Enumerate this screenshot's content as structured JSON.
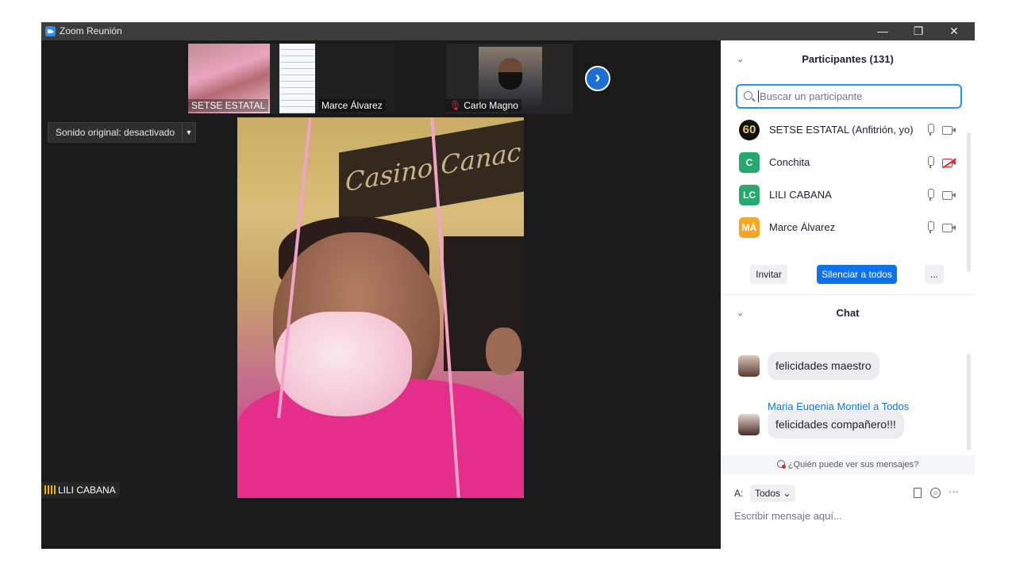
{
  "window": {
    "title": "Zoom Reunión",
    "controls": {
      "minimize": "—",
      "restore": "❐",
      "close": "✕"
    }
  },
  "gallery": {
    "thumbnails": [
      {
        "name": "SETSE ESTATAL",
        "muted": false
      },
      {
        "name": "Marce Álvarez",
        "muted": false
      },
      {
        "name": "Carlo Magno",
        "muted": true
      }
    ],
    "next_icon": "chevron-right-icon"
  },
  "sound_dropdown": {
    "label": "Sonido original: desactivado"
  },
  "main_video": {
    "speaker_name": "LILI CABANA",
    "sign_text": "Casino Canac"
  },
  "participants": {
    "title": "Participantes (131)",
    "search_placeholder": "Buscar un participante",
    "list": [
      {
        "initials": "60",
        "name": "SETSE ESTATAL (Anfitrión, yo)",
        "color": "#111111",
        "video_off": false
      },
      {
        "initials": "C",
        "name": "Conchita",
        "color": "#26a96c",
        "video_off": true
      },
      {
        "initials": "LC",
        "name": "LILI CABANA",
        "color": "#26a96c",
        "video_off": false
      },
      {
        "initials": "MÁ",
        "name": "Marce Álvarez",
        "color": "#f5a623",
        "video_off": false
      },
      {
        "initials": "",
        "name": "",
        "color": "#8e44ad",
        "video_off": false
      }
    ],
    "buttons": {
      "invite": "Invitar",
      "mute_all": "Silenciar a todos",
      "more": "..."
    }
  },
  "chat": {
    "title": "Chat",
    "messages": [
      {
        "sender": "",
        "text": "felicidades maestro"
      },
      {
        "sender": "Maria Eugenia Montiel a Todos",
        "text": "felicidades compañero!!!"
      }
    ],
    "visibility_text": "¿Quién puede ver sus mensajes?",
    "to_label": "A:",
    "to_value": "Todos",
    "input_placeholder": "Escribir mensaje aquí..."
  },
  "colors": {
    "accent": "#0e72ed",
    "search_border": "#2d8cff",
    "muted_red": "#e02828",
    "video_bg": "#1a1a1a"
  }
}
